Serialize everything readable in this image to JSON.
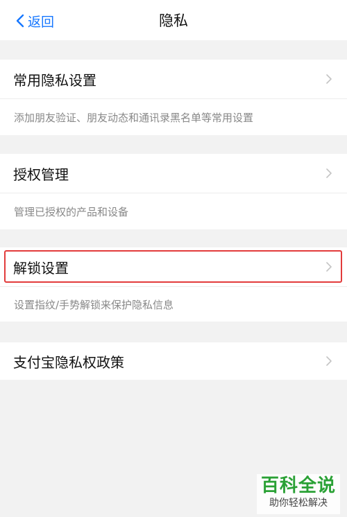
{
  "navbar": {
    "back_label": "返回",
    "title": "隐私"
  },
  "sections": [
    {
      "label": "常用隐私设置",
      "description": "添加朋友验证、朋友动态和通讯录黑名单等常用设置"
    },
    {
      "label": "授权管理",
      "description": "管理已授权的产品和设备"
    },
    {
      "label": "解锁设置",
      "description": "设置指纹/手势解锁来保护隐私信息"
    },
    {
      "label": "支付宝隐私权政策"
    }
  ],
  "watermark": {
    "main": "百科全说",
    "sub": "助你轻松解决"
  },
  "colors": {
    "accent": "#1677ff",
    "highlight": "#e23b3b",
    "watermark": "#2aa135"
  }
}
